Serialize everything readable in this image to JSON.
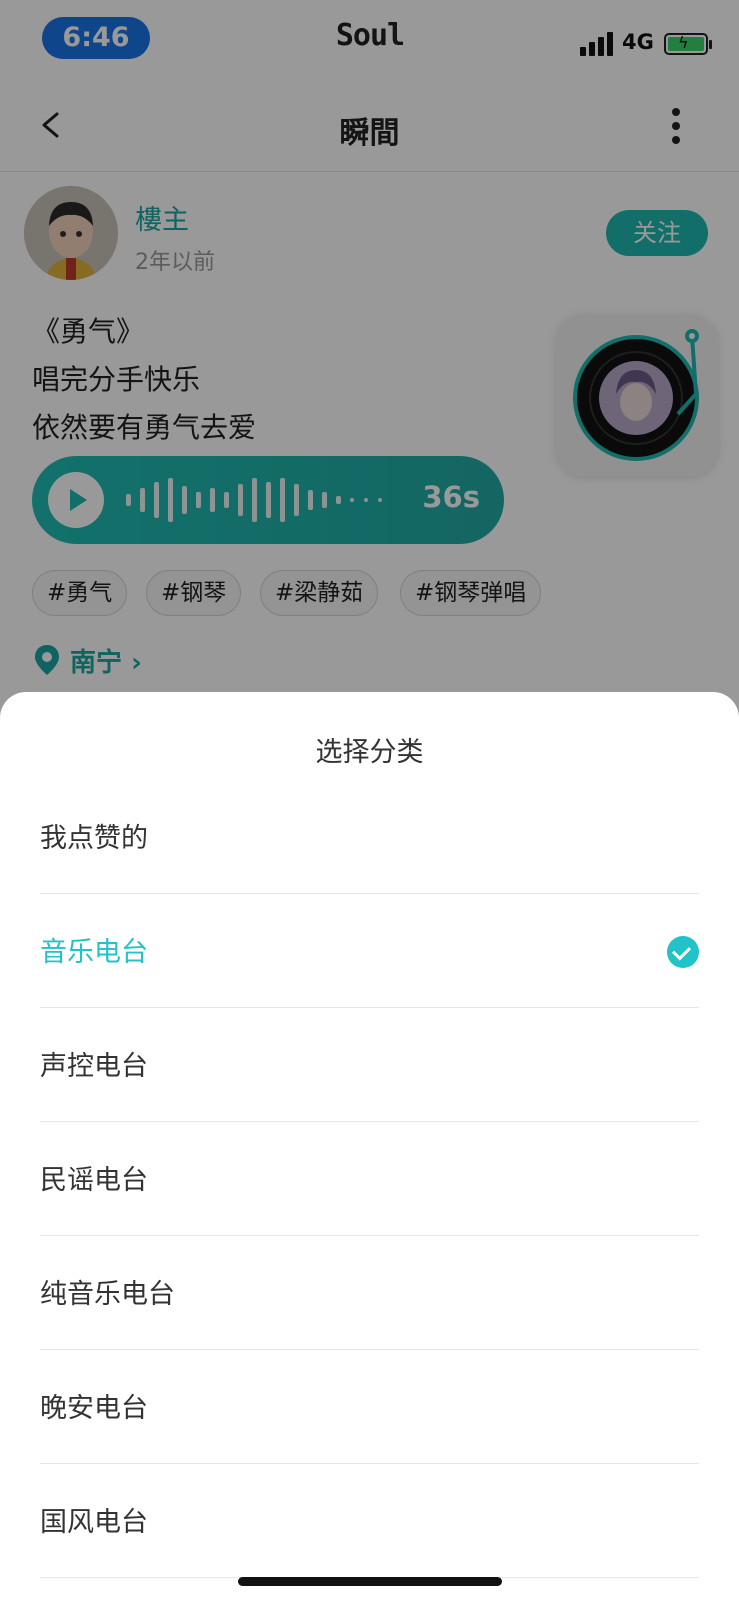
{
  "status_bar": {
    "time": "6:46",
    "carrier": "Soul",
    "network": "4G"
  },
  "nav": {
    "title": "瞬間"
  },
  "post": {
    "author": "樓主",
    "time": "2年以前",
    "follow_label": "关注",
    "lines": [
      "《勇气》",
      "唱完分手快乐",
      "依然要有勇气去爱"
    ],
    "duration": "36s",
    "tags": [
      "#勇气",
      "#钢琴",
      "#梁静茹",
      "#钢琴弹唱"
    ],
    "location": "南宁"
  },
  "sheet": {
    "title": "选择分类",
    "options": [
      {
        "label": "我点赞的",
        "selected": false
      },
      {
        "label": "音乐电台",
        "selected": true
      },
      {
        "label": "声控电台",
        "selected": false
      },
      {
        "label": "民谣电台",
        "selected": false
      },
      {
        "label": "纯音乐电台",
        "selected": false
      },
      {
        "label": "晚安电台",
        "selected": false
      },
      {
        "label": "国风电台",
        "selected": false
      }
    ]
  },
  "colors": {
    "accent": "#1fb7b0",
    "selected": "#21c2c8",
    "time_pill": "#1a73e8"
  },
  "icons": [
    "back-icon",
    "more-icon",
    "play-icon",
    "location-pin-icon",
    "check-icon",
    "signal-icon",
    "battery-icon",
    "record-icon"
  ]
}
